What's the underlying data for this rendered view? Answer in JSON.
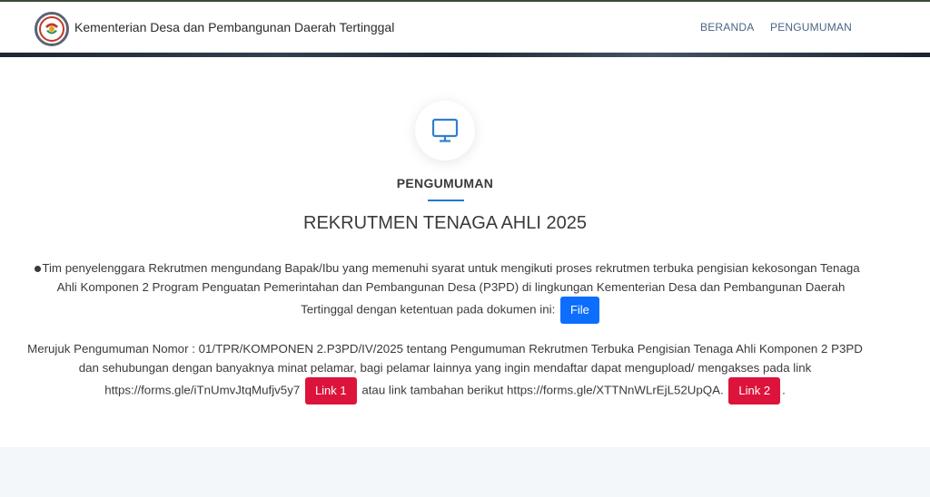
{
  "header": {
    "brand": "Kementerian Desa dan Pembangunan Daerah Tertinggal",
    "nav": [
      "BERANDA",
      "PENGUMUMAN"
    ]
  },
  "section": {
    "icon": "monitor-icon",
    "title": "PENGUMUMAN",
    "headline": "REKRUTMEN TENAGA AHLI 2025"
  },
  "announcement": {
    "paragraph1": "Tim penyelenggara Rekrutmen mengundang Bapak/Ibu yang memenuhi syarat untuk mengikuti proses rekrutmen terbuka pengisian kekosongan Tenaga Ahli Komponen 2 Program Penguatan Pemerintahan dan Pembangunan Desa (P3PD) di lingkungan Kementerian Desa dan Pembangunan Daerah Tertinggal dengan ketentuan pada dokumen ini:",
    "file_button": "File",
    "paragraph2_part1": "Merujuk Pengumuman Nomor : 01/TPR/KOMPONEN 2.P3PD/IV/2025 tentang Pengumuman Rekrutmen Terbuka Pengisian Tenaga Ahli Komponen 2 P3PD dan sehubungan dengan banyaknya minat pelamar, bagi pelamar lainnya yang ingin mendaftar dapat mengupload/ mengakses pada link https://forms.gle/iTnUmvJtqMufjv5y7",
    "link1_button": "Link 1",
    "paragraph2_part2": "atau link tambahan berikut https://forms.gle/XTTNnWLrEjL52UpQA.",
    "link2_button": "Link 2",
    "paragraph2_end": "."
  },
  "colors": {
    "primary_blue": "#0d6efd",
    "link_red": "#dc143c",
    "nav_text": "#4b6584",
    "accent_rule": "#1f7acc"
  }
}
